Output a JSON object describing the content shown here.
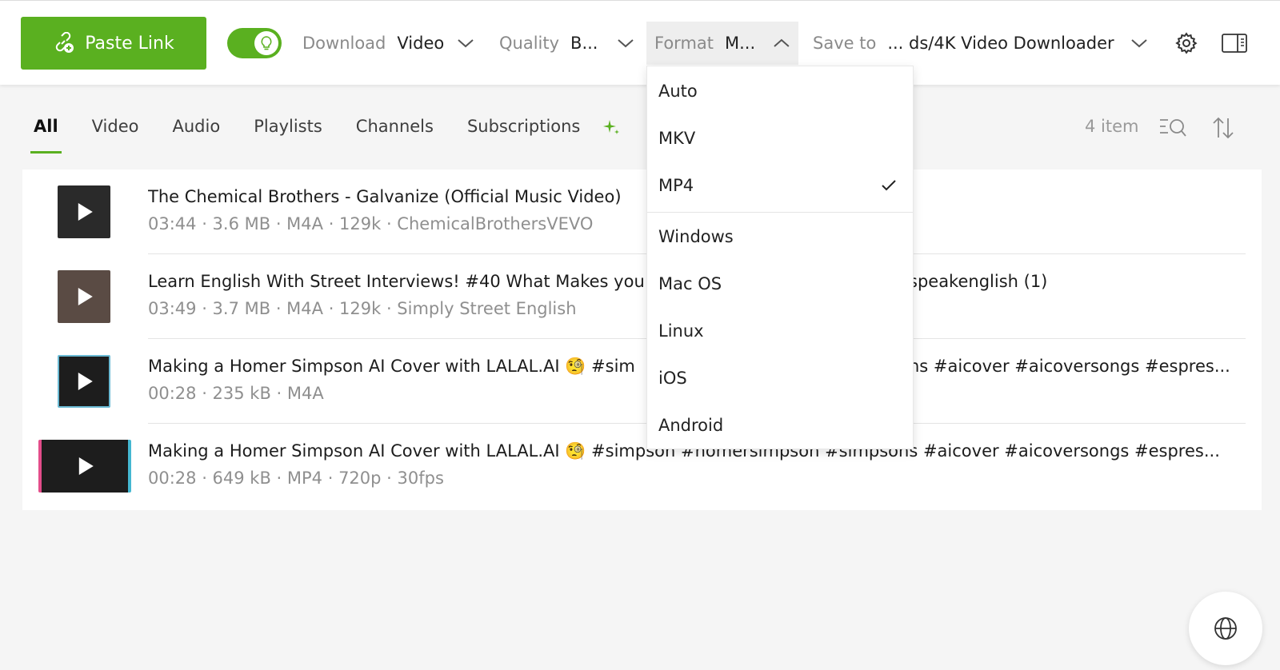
{
  "toolbar": {
    "paste_label": "Paste Link",
    "download_label": "Download",
    "download_value": "Video",
    "quality_label": "Quality",
    "quality_value": "B...",
    "format_label": "Format",
    "format_value": "M...",
    "save_label": "Save to",
    "save_value": "... ds/4K Video Downloader",
    "smart_mode_on": true,
    "accent_color": "#5ab020"
  },
  "tabs": [
    "All",
    "Video",
    "Audio",
    "Playlists",
    "Channels",
    "Subscriptions"
  ],
  "active_tab": "All",
  "item_count": "4 item",
  "items": [
    {
      "title": "The Chemical Brothers - Galvanize (Official Music Video)",
      "meta": "03:44 · 3.6 MB · M4A · 129k · ChemicalBrothersVEVO"
    },
    {
      "title": "Learn English With Street Interviews! #40 What Makes you",
      "title_tail": "speakenglish (1)",
      "meta": "03:49 · 3.7 MB · M4A · 129k · Simply Street English"
    },
    {
      "title": "Making a Homer Simpson AI Cover with LALAL.AI 🧐 #sim",
      "title_tail": "ns #aicover #aicoversongs #espres...",
      "meta": "00:28 · 235 kB · M4A"
    },
    {
      "title": "Making a Homer Simpson AI Cover with LALAL.AI 🧐 #simpson #homersimpson #simpsons #aicover #aicoversongs #espres...",
      "meta": "00:28 · 649 kB · MP4 · 720p · 30fps"
    }
  ],
  "format_menu": {
    "options": [
      "Auto",
      "MKV",
      "MP4",
      "Windows",
      "Mac OS",
      "Linux",
      "iOS",
      "Android"
    ],
    "selected": "MP4"
  }
}
